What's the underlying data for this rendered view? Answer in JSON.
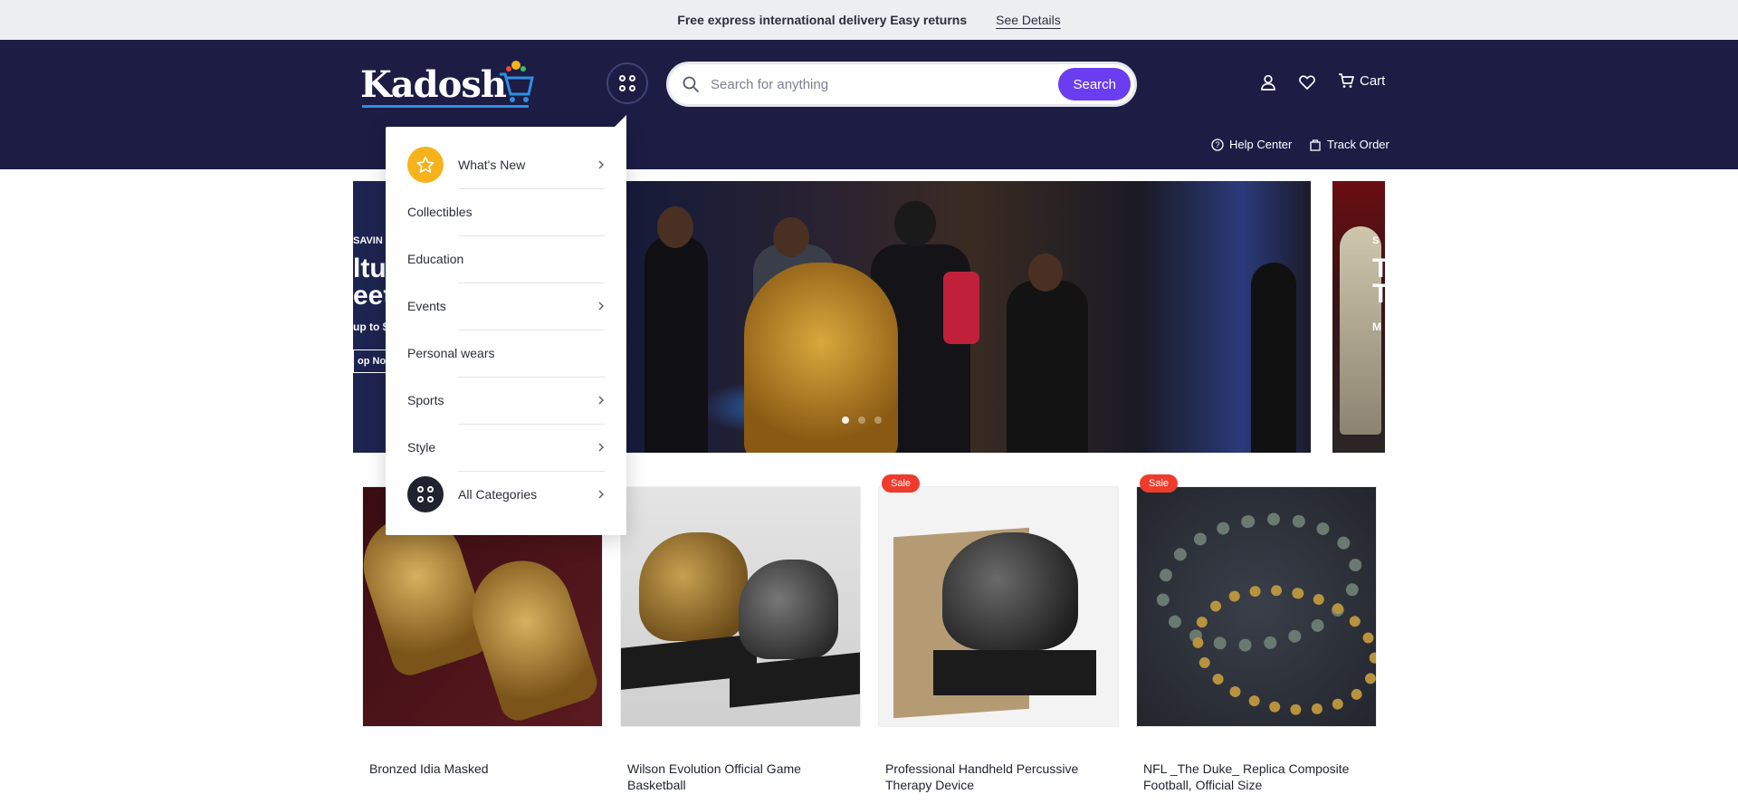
{
  "announcement": {
    "promo_text": "Free express international delivery Easy returns",
    "details_link": "See Details"
  },
  "header": {
    "logo_text": "Kadosh",
    "search": {
      "placeholder": "Search for anything",
      "button_label": "Search"
    },
    "cart_label": "Cart",
    "help_center_label": "Help Center",
    "track_order_label": "Track Order"
  },
  "hero": {
    "left_slide": {
      "kicker": "SAVIN",
      "heading_line1": "ltur",
      "heading_line2": "eets",
      "subtext": "up to $",
      "cta": "op Now"
    },
    "right_slide": {
      "kicker": "S",
      "heading_line1": "T",
      "heading_line2": "T",
      "subtext": "M"
    },
    "active_dot": 0,
    "dot_count": 3
  },
  "category_menu": {
    "items": [
      {
        "label": "What's New",
        "icon": "star-icon",
        "has_submenu": true
      },
      {
        "label": "Collectibles",
        "has_submenu": false
      },
      {
        "label": "Education",
        "has_submenu": false
      },
      {
        "label": "Events",
        "has_submenu": true
      },
      {
        "label": "Personal wears",
        "has_submenu": false
      },
      {
        "label": "Sports",
        "has_submenu": true
      },
      {
        "label": "Style",
        "has_submenu": true
      },
      {
        "label": "All Categories",
        "icon": "grid-icon",
        "has_submenu": true
      }
    ]
  },
  "products": [
    {
      "title": "Bronzed Idia Masked",
      "sale": false,
      "sale_label": ""
    },
    {
      "title": "Wilson Evolution Official Game Basketball",
      "sale": false,
      "sale_label": ""
    },
    {
      "title": "Professional Handheld Percussive Therapy Device",
      "sale": true,
      "sale_label": "Sale"
    },
    {
      "title": "NFL _The Duke_ Replica Composite Football, Official Size",
      "sale": true,
      "sale_label": "Sale"
    }
  ],
  "colors": {
    "header_bg": "#1c1c45",
    "accent": "#6a3df0",
    "sale_badge": "#ef3b2c",
    "star_badge": "#f5b21a"
  }
}
